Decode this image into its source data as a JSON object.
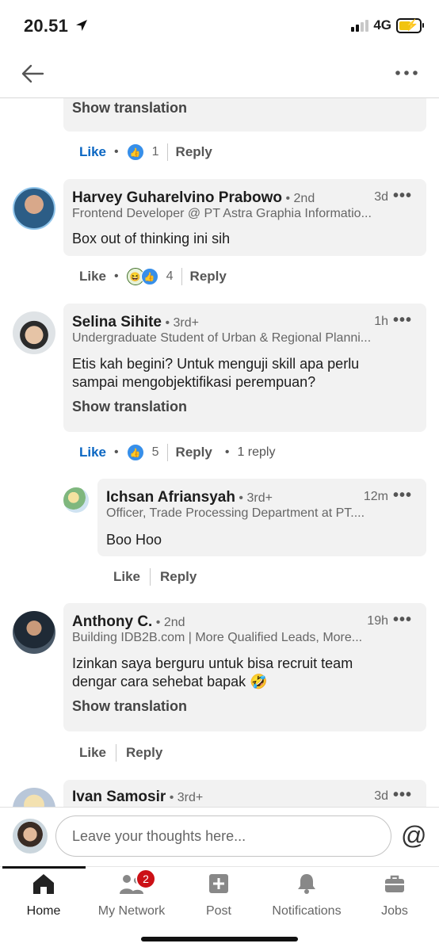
{
  "status": {
    "time": "20.51",
    "network": "4G"
  },
  "top_comment_tail": {
    "show_translation": "Show translation",
    "like": "Like",
    "reaction_count": "1",
    "reply": "Reply"
  },
  "comments": [
    {
      "name": "Harvey Guharelvino Prabowo",
      "degree": "• 2nd",
      "headline": "Frontend Developer @ PT Astra Graphia Informatio...",
      "time": "3d",
      "text": "Box out of thinking ini sih",
      "like": "Like",
      "reaction_count": "4",
      "reply": "Reply"
    },
    {
      "name": "Selina Sihite",
      "degree": "• 3rd+",
      "headline": "Undergraduate Student of Urban & Regional Planni...",
      "time": "1h",
      "text_line1": "Etis kah begini? Untuk menguji skill apa perlu",
      "text_line2": "sampai mengobjektifikasi perempuan?",
      "show_translation": "Show translation",
      "like": "Like",
      "reaction_count": "5",
      "reply": "Reply",
      "replies_count": "1 reply"
    },
    {
      "name": "Ichsan Afriansyah",
      "degree": "• 3rd+",
      "headline": "Officer, Trade Processing Department at PT....",
      "time": "12m",
      "text": "Boo Hoo",
      "like": "Like",
      "reply": "Reply"
    },
    {
      "name": "Anthony C.",
      "degree": "• 2nd",
      "headline": "Building IDB2B.com | More Qualified Leads, More...",
      "time": "19h",
      "text_line1": "Izinkan saya berguru untuk bisa recruit team",
      "text_line2": "dengar cara sehebat bapak 🤣",
      "show_translation": "Show translation",
      "like": "Like",
      "reply": "Reply"
    },
    {
      "name": "Ivan Samosir",
      "degree": "• 3rd+",
      "time": "3d"
    }
  ],
  "composer": {
    "placeholder": "Leave your thoughts here..."
  },
  "tabs": [
    {
      "label": "Home",
      "icon": "home-icon"
    },
    {
      "label": "My Network",
      "icon": "network-icon",
      "badge": "2"
    },
    {
      "label": "Post",
      "icon": "post-icon"
    },
    {
      "label": "Notifications",
      "icon": "bell-icon"
    },
    {
      "label": "Jobs",
      "icon": "briefcase-icon"
    }
  ],
  "colors": {
    "link_blue": "#0a66c2",
    "reaction_blue": "#378fe9",
    "badge_red": "#cc1016",
    "bubble_bg": "#f2f2f2"
  }
}
